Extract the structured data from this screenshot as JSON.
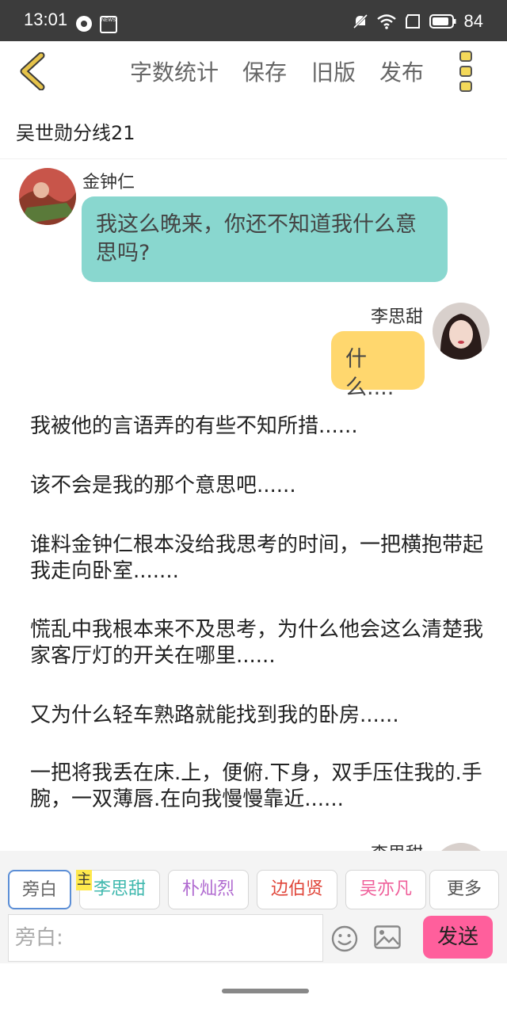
{
  "status_bar": {
    "time": "13:01",
    "news_icon_text": "NEWS",
    "battery": "84"
  },
  "toolbar": {
    "word_count": "字数统计",
    "save": "保存",
    "old_version": "旧版",
    "publish": "发布"
  },
  "story": {
    "title": "吴世勋分线21"
  },
  "messages": [
    {
      "speaker": "金钟仁",
      "text": "我这么晚来，你还不知道我什么意思吗?"
    },
    {
      "speaker": "李思甜",
      "text": "什么...."
    }
  ],
  "narrations": [
    "我被他的言语弄的有些不知所措......",
    "该不会是我的那个意思吧......",
    "谁料金钟仁根本没给我思考的时间，一把横抱带起我走向卧室.......",
    "慌乱中我根本来不及思考，为什么他会这么清楚我家客厅灯的开关在哪里......",
    "又为什么轻车熟路就能找到我的卧房......",
    "一把将我丢在床.上，便俯.下身，双手压住我的.手腕，一双薄唇.在向我慢慢靠近......"
  ],
  "partial_speaker": "李思甜",
  "roles": {
    "main_badge": "主",
    "tabs": [
      {
        "label": "旁白",
        "color": "#666666"
      },
      {
        "label": "李思甜",
        "color": "#3fb8ae"
      },
      {
        "label": "朴灿烈",
        "color": "#b06ad0"
      },
      {
        "label": "边伯贤",
        "color": "#e0463a"
      },
      {
        "label": "吴亦凡",
        "color": "#ef5f9a"
      },
      {
        "label": "更多",
        "color": "#555555"
      }
    ]
  },
  "input": {
    "placeholder": "旁白:"
  },
  "send_label": "发送",
  "colors": {
    "bubble_left": "#89d7cf",
    "bubble_right": "#ffd76e",
    "send_button": "#ff5f9c",
    "back_arrow": "#e6c34a"
  }
}
